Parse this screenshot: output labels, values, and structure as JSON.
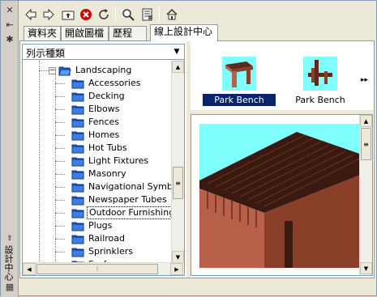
{
  "window": {
    "vertical_title": "設計中心"
  },
  "toolbar": {
    "icons": [
      "back-icon",
      "forward-icon",
      "up-folder-icon",
      "stop-icon",
      "reload-icon",
      "search-icon",
      "favorites-icon",
      "home-icon"
    ]
  },
  "tabs": [
    {
      "label": "資料夾",
      "active": false
    },
    {
      "label": "開啟圖檔",
      "active": false
    },
    {
      "label": "歷程",
      "active": false
    },
    {
      "label": "線上設計中心",
      "active": true
    }
  ],
  "left_panel": {
    "combo_label": "列示種類",
    "tree": {
      "parent": "Landscaping",
      "children": [
        "Accessories",
        "Decking",
        "Elbows",
        "Fences",
        "Homes",
        "Hot Tubs",
        "Light Fixtures",
        "Masonry",
        "Navigational Symbol",
        "Newspaper Tubes",
        "Outdoor Furnishings",
        "Plugs",
        "Railroad",
        "Sprinklers",
        "Surfaces"
      ],
      "selected": "Outdoor Furnishings"
    }
  },
  "right_panel": {
    "items": [
      {
        "label": "Park Bench",
        "selected": true
      },
      {
        "label": "Park Bench",
        "selected": false
      }
    ]
  },
  "colors": {
    "accent": "#0a246a",
    "folder": "#1e62d0",
    "preview_bg": "#80ffff",
    "bench": "#b8604a"
  }
}
